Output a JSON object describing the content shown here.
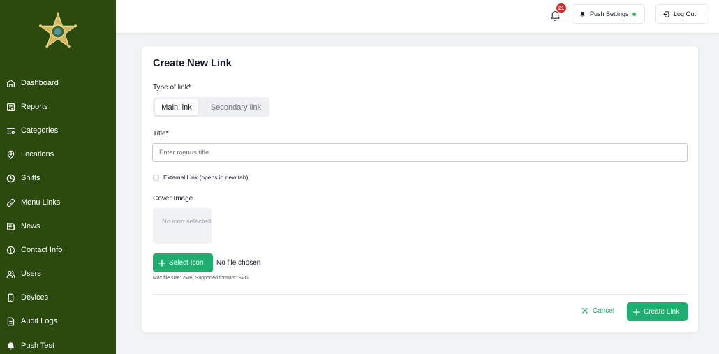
{
  "sidebar": {
    "items": [
      {
        "label": "Dashboard",
        "icon": "home-icon"
      },
      {
        "label": "Reports",
        "icon": "report-icon"
      },
      {
        "label": "Categories",
        "icon": "categories-icon"
      },
      {
        "label": "Locations",
        "icon": "location-pin-icon"
      },
      {
        "label": "Shifts",
        "icon": "clock-icon"
      },
      {
        "label": "Menu Links",
        "icon": "link-icon"
      },
      {
        "label": "News",
        "icon": "newspaper-icon"
      },
      {
        "label": "Contact Info",
        "icon": "info-circle-icon"
      },
      {
        "label": "Users",
        "icon": "users-icon"
      },
      {
        "label": "Devices",
        "icon": "phone-icon"
      },
      {
        "label": "Audit Logs",
        "icon": "document-icon"
      },
      {
        "label": "Push Test",
        "icon": "bell-icon"
      }
    ]
  },
  "header": {
    "notification_count": "21",
    "push_settings_label": "Push Settings",
    "logout_label": "Log Out"
  },
  "form": {
    "title": "Create New Link",
    "type_label": "Type of link*",
    "type_options": [
      "Main link",
      "Secondary link"
    ],
    "selected_type": "Main link",
    "title_label": "Title*",
    "title_value": "",
    "title_placeholder": "Enter menus title",
    "external_label": "External Link (opens in new tab)",
    "external_checked": false,
    "cover_label": "Cover Image",
    "preview_text": "No icon selected",
    "select_icon_label": "Select Icon",
    "no_file_label": "No file chosen",
    "hint": "Max file size: 2MB, Supported formats: SVG",
    "cancel_label": "Cancel",
    "create_label": "Create Link"
  },
  "colors": {
    "sidebar_bg": "#2b4a0e",
    "accent": "#1fae6f",
    "badge": "#dc2626",
    "status_dot": "#22c55e"
  }
}
